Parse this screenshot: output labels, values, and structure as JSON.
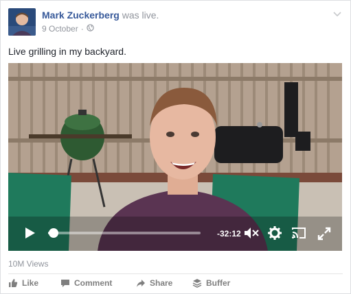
{
  "post": {
    "author": "Mark Zuckerberg",
    "status": "was live.",
    "date": "9 October",
    "separator": "·",
    "text": "Live grilling in my backyard."
  },
  "video": {
    "remaining_time": "-32:12",
    "progress": 0.02
  },
  "stats": {
    "views": "10M Views"
  },
  "actions": [
    {
      "label": "Like",
      "icon": "thumbs-up-icon"
    },
    {
      "label": "Comment",
      "icon": "comment-icon"
    },
    {
      "label": "Share",
      "icon": "share-icon"
    },
    {
      "label": "Buffer",
      "icon": "buffer-icon"
    }
  ],
  "colors": {
    "author_link": "#365899",
    "meta_gray": "#90949c",
    "action_gray": "#7f7f7f"
  }
}
